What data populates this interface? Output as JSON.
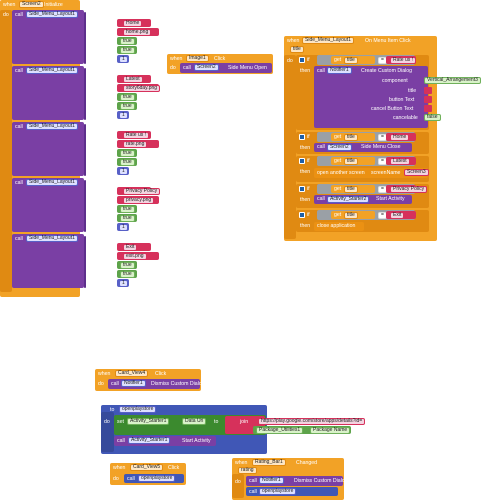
{
  "palette": {
    "event_orange": "#f2a226",
    "procedure_purple": "#7a3fa4",
    "text_pink": "#d6315b",
    "logic_green": "#5da34a",
    "math_blue": "#5860c7"
  },
  "screen_init": {
    "when": "when",
    "component": "Screen2",
    "event": "Initialize",
    "do": "do",
    "items": [
      {
        "call": "call",
        "component": "Side_Menu_Layout1",
        "method": "Add Item",
        "title_label": "title",
        "title": "Home",
        "image_label": "image",
        "image": "home.png",
        "enabled_label": "enabled",
        "enabled": "true",
        "checked_label": "checked",
        "checked": "true",
        "group_label": "group",
        "group": "1"
      },
      {
        "call": "call",
        "component": "Side_Menu_Layout1",
        "method": "Add Item",
        "title_label": "title",
        "title": "Latest",
        "image_label": "image",
        "image": "story6day.png",
        "enabled_label": "enabled",
        "enabled": "true",
        "checked_label": "checked",
        "checked": "true",
        "group_label": "group",
        "group": "1"
      },
      {
        "call": "call",
        "component": "Side_Menu_Layout1",
        "method": "Add Item",
        "title_label": "title",
        "title": "Rate us !",
        "image_label": "image",
        "image": "rate.png",
        "enabled_label": "enabled",
        "enabled": "true",
        "checked_label": "checked",
        "checked": "true",
        "group_label": "group",
        "group": "1"
      },
      {
        "call": "call",
        "component": "Side_Menu_Layout1",
        "method": "Add Item",
        "title_label": "title",
        "title": "Privacy Policy",
        "image_label": "image",
        "image": "privacy.png",
        "enabled_label": "enabled",
        "enabled": "true",
        "checked_label": "checked",
        "checked": "true",
        "group_label": "group",
        "group": "1"
      },
      {
        "call": "call",
        "component": "Side_Menu_Layout1",
        "method": "Add Item",
        "title_label": "title",
        "title": "Exit",
        "image_label": "image",
        "image": "exit.png",
        "enabled_label": "enabled",
        "enabled": "true",
        "checked_label": "checked",
        "checked": "true",
        "group_label": "group",
        "group": "1"
      }
    ]
  },
  "image_click": {
    "when": "when",
    "component": "Image1",
    "event": "Click",
    "do": "do",
    "call": "call",
    "target": "Screen2",
    "method": "Side Menu Open"
  },
  "menu_click": {
    "when": "when",
    "component": "Side_Menu_Layout1",
    "event": "On Menu Item Click",
    "param": "title",
    "do": "do",
    "if": "if",
    "then": "then",
    "get": "get",
    "var": "title",
    "eq": "=",
    "c1": {
      "value": "Rate us !",
      "call": "call",
      "component": "Notifier1",
      "method": "Create Custom Dialog",
      "component_label": "component",
      "component_value": "Vertical_Arrangement3",
      "title_label": "title",
      "button_text_label": "button Text",
      "cancel_label": "cancel Button Text",
      "cancelable_label": "cancelable",
      "cancelable": "false",
      "empty": "\" \""
    },
    "c2": {
      "value": "Home",
      "call": "call",
      "component": "Screen2",
      "method": "Side Menu Close"
    },
    "c3": {
      "value": "Latest",
      "action": "open another screen",
      "screenName_label": "screenName",
      "screenName": "Screen3"
    },
    "c4": {
      "value": "Privacy Policy",
      "call": "call",
      "component": "Activity_Starter2",
      "method": "Start Activity"
    },
    "c5": {
      "value": "Exit",
      "action": "close application"
    }
  },
  "card4": {
    "when": "when",
    "component": "Card_View4",
    "event": "Click",
    "do": "do",
    "call": "call",
    "target": "Notifier1",
    "method": "Dismiss Custom Dialog"
  },
  "openplaystore": {
    "to": "to",
    "name": "openplaystore",
    "do": "do",
    "set": "set",
    "component": "Activity_Starter1",
    "prop": "Data Uri",
    "to2": "to",
    "join": "join",
    "url": "https://play.google.com/store/apps/details?id=",
    "pkg_component": "Package_Utilities1",
    "pkg_prop": "Package Name",
    "call": "call",
    "call_component": "Activity_Starter1",
    "call_method": "Start Activity"
  },
  "card5": {
    "when": "when",
    "component": "Card_View5",
    "event": "Click",
    "do": "do",
    "call": "call",
    "target": "openplaystore"
  },
  "rating": {
    "when": "when",
    "component": "Rating_Bar1",
    "event": "Changed",
    "param": "rating",
    "do": "do",
    "call": "call",
    "target": "Notifier1",
    "method": "Dismiss Custom Dialog",
    "call2": "call",
    "target2": "openplaystore"
  }
}
